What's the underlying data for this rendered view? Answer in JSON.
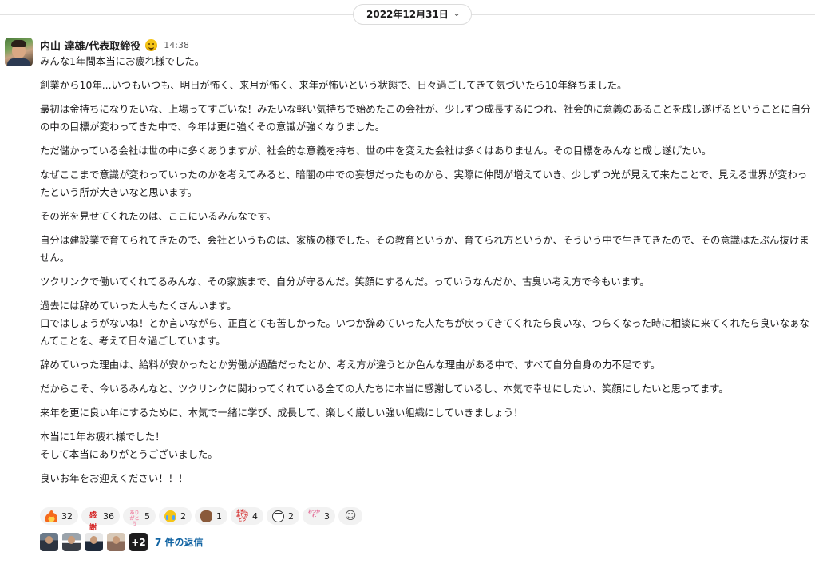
{
  "date_divider": {
    "label": "2022年12月31日"
  },
  "author": {
    "name": "内山 達雄/代表取締役",
    "time": "14:38"
  },
  "message": {
    "paragraphs": [
      "みんな1年間本当にお疲れ様でした。",
      "創業から10年...いつもいつも、明日が怖く、来月が怖く、来年が怖いという状態で、日々過ごしてきて気づいたら10年経ちました。",
      "最初は金持ちになりたいな、上場ってすごいな！みたいな軽い気持ちで始めたこの会社が、少しずつ成長するにつれ、社会的に意義のあることを成し遂げるということに自分の中の目標が変わってきた中で、今年は更に強くその意識が強くなりました。",
      "ただ儲かっている会社は世の中に多くありますが、社会的な意義を持ち、世の中を変えた会社は多くはありません。その目標をみんなと成し遂げたい。",
      "なぜここまで意識が変わっていったのかを考えてみると、暗闇の中での妄想だったものから、実際に仲間が増えていき、少しずつ光が見えて来たことで、見える世界が変わったという所が大きいなと思います。",
      "その光を見せてくれたのは、ここにいるみんなです。",
      "自分は建設業で育てられてきたので、会社というものは、家族の様でした。その教育というか、育てられ方というか、そういう中で生きてきたので、その意識はたぶん抜けません。",
      "ツクリンクで働いてくれてるみんな、その家族まで、自分が守るんだ。笑顔にするんだ。っていうなんだか、古臭い考え方で今もいます。",
      "過去には辞めていった人もたくさんいます。\n口ではしょうがないね！とか言いながら、正直とても苦しかった。いつか辞めていった人たちが戻ってきてくれたら良いな、つらくなった時に相談に来てくれたら良いなぁなんてことを、考えて日々過ごしています。",
      "辞めていった理由は、給料が安かったとか労働が過酷だったとか、考え方が違うとか色んな理由がある中で、すべて自分自身の力不足です。",
      "だからこそ、今いるみんなと、ツクリンクに関わってくれている全ての人たちに本当に感謝しているし、本気で幸せにしたい、笑顔にしたいと思ってます。",
      "来年を更に良い年にするために、本気で一緒に学び、成長して、楽しく厳しい強い組織にしていきましょう！",
      "本当に1年お疲れ様でした！\nそして本当にありがとうございました。",
      "良いお年をお迎えください！！！"
    ]
  },
  "reactions": [
    {
      "icon": "fire-emoji",
      "count": "32"
    },
    {
      "icon": "kansha-stamp",
      "count": "36",
      "stamp_text": "感謝"
    },
    {
      "icon": "arigatou-pink-stamp",
      "count": "5",
      "stamp_text": "ありがとう"
    },
    {
      "icon": "crying-face-emoji",
      "count": "2"
    },
    {
      "icon": "fist-bump-emoji",
      "count": "1"
    },
    {
      "icon": "hontou-arigatou-stamp",
      "count": "4",
      "stamp_text": "本当にありがとう"
    },
    {
      "icon": "face-emoji",
      "count": "2"
    },
    {
      "icon": "otsukare-stamp",
      "count": "3",
      "stamp_text": "おつかれ"
    }
  ],
  "thread": {
    "more_avatars": "+2",
    "reply_count_label": "7 件の返信"
  }
}
